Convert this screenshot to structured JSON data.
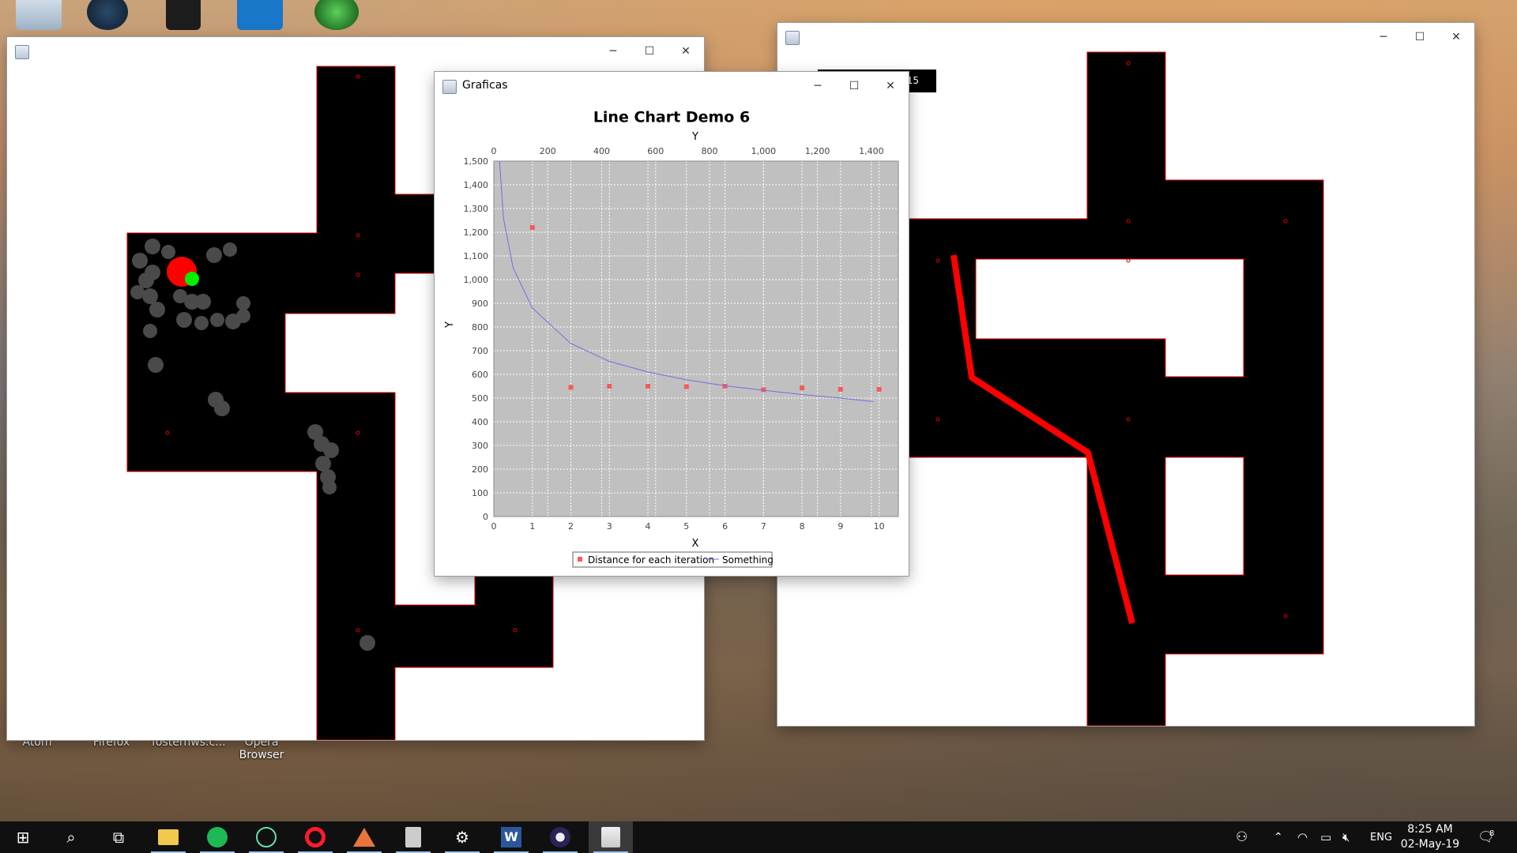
{
  "desktop": {
    "icon_labels": [
      "Atom",
      "Firefox",
      "fosternws.c...",
      "Opera\nBrowser"
    ]
  },
  "left_window": {
    "title": "",
    "controls": {
      "minimize": "─",
      "maximize": "☐",
      "close": "✕"
    }
  },
  "right_window": {
    "title": "",
    "label_fragment": "15",
    "controls": {
      "minimize": "─",
      "maximize": "☐",
      "close": "✕"
    }
  },
  "chart_window": {
    "title": "Graficas",
    "controls": {
      "minimize": "─",
      "maximize": "☐",
      "close": "✕"
    }
  },
  "chart_data": {
    "type": "scatter",
    "title": "Line Chart Demo 6",
    "xlabel": "X",
    "ylabel": "Y",
    "top_axis_label": "Y",
    "xlim": [
      0,
      10.5
    ],
    "ylim": [
      0,
      1500
    ],
    "top_xlim": [
      0,
      1500
    ],
    "x_ticks": [
      "0",
      "1",
      "2",
      "3",
      "4",
      "5",
      "6",
      "7",
      "8",
      "9",
      "10"
    ],
    "y_ticks": [
      "0",
      "100",
      "200",
      "300",
      "400",
      "500",
      "600",
      "700",
      "800",
      "900",
      "1,000",
      "1,100",
      "1,200",
      "1,300",
      "1,400",
      "1,500"
    ],
    "top_ticks": [
      "0",
      "200",
      "400",
      "600",
      "800",
      "1,000",
      "1,200",
      "1,400"
    ],
    "grid": true,
    "legend_position": "bottom",
    "series": [
      {
        "name": "Distance for each iteration",
        "kind": "points",
        "color": "#f55a5a",
        "x": [
          1,
          2,
          3,
          4,
          5,
          6,
          7,
          8,
          9,
          10
        ],
        "y": [
          1220,
          545,
          550,
          550,
          548,
          550,
          535,
          543,
          537,
          537
        ]
      },
      {
        "name": "Something",
        "kind": "line",
        "color": "#6f6fe0",
        "x": [
          0.15,
          0.25,
          0.5,
          1,
          2,
          3,
          4,
          5,
          6,
          7,
          8,
          9,
          9.85
        ],
        "y": [
          1500,
          1260,
          1050,
          880,
          730,
          655,
          610,
          577,
          552,
          533,
          515,
          500,
          485
        ]
      }
    ]
  },
  "taskbar": {
    "apps": [
      "start",
      "search",
      "task-view",
      "file-explorer",
      "spotify",
      "atom",
      "opera",
      "matlab",
      "calculator",
      "settings",
      "word",
      "eclipse",
      "java"
    ],
    "language": "ENG",
    "time": "8:25 AM",
    "date": "02-May-19",
    "notification_count": "8"
  }
}
